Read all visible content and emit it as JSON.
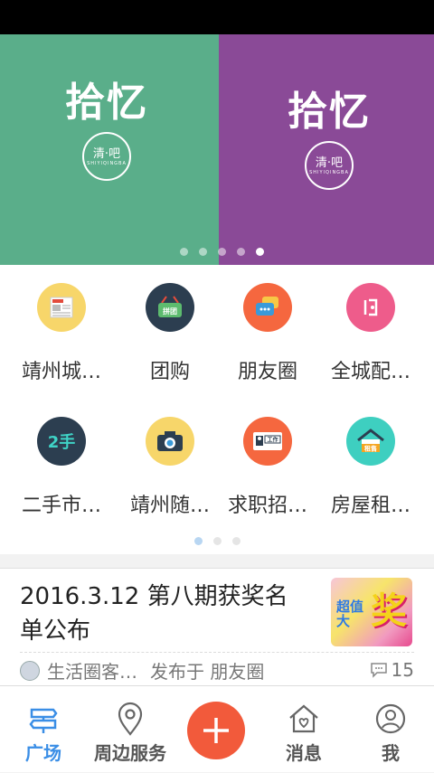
{
  "banner": {
    "slides": [
      {
        "title": "拾忆",
        "badge": "清·吧",
        "badge_sub": "SHIYIQINGBA",
        "color": "#5aae8a"
      },
      {
        "title": "拾忆",
        "badge": "清·吧",
        "badge_sub": "SHIYIQINGBA",
        "color": "#8a4a97"
      }
    ],
    "dot_count": 5,
    "active_dot": 4
  },
  "grid": {
    "items": [
      {
        "label": "靖州城…",
        "icon": "newspaper-icon",
        "color": "#f7d66a",
        "glyph": "大新闻"
      },
      {
        "label": "团购",
        "icon": "basket-icon",
        "color": "#2c3e50",
        "glyph": "拼团"
      },
      {
        "label": "朋友圈",
        "icon": "chat-bubbles-icon",
        "color": "#f5673f",
        "glyph": ""
      },
      {
        "label": "全城配…",
        "icon": "delivery-icon",
        "color": "#ee5c8b",
        "glyph": ""
      },
      {
        "label": "二手市…",
        "icon": "secondhand-icon",
        "color": "#2c3e50",
        "glyph": "2手"
      },
      {
        "label": "靖州随…",
        "icon": "camera-icon",
        "color": "#f7d66a",
        "glyph": ""
      },
      {
        "label": "求职招…",
        "icon": "job-card-icon",
        "color": "#f5673f",
        "glyph": "工作"
      },
      {
        "label": "房屋租…",
        "icon": "house-rent-icon",
        "color": "#3ecfc0",
        "glyph": "租售"
      }
    ],
    "page_count": 3,
    "active_page": 0
  },
  "news": {
    "title": "2016.3.12  第八期获奖名单公布",
    "author": "生活圈客…",
    "published_in": "发布于 朋友圈",
    "comments": "15",
    "thumb_big": "奖",
    "thumb_small": "超值大"
  },
  "tabbar": {
    "tabs": [
      {
        "label": "广场",
        "icon": "signpost-icon"
      },
      {
        "label": "周边服务",
        "icon": "location-pin-icon"
      },
      {
        "label": "",
        "icon": "plus-icon"
      },
      {
        "label": "消息",
        "icon": "house-heart-icon"
      },
      {
        "label": "我",
        "icon": "user-icon"
      }
    ],
    "active": 0
  },
  "colors": {
    "accent_blue": "#3a8ee6",
    "plus_red": "#f25a3b"
  }
}
